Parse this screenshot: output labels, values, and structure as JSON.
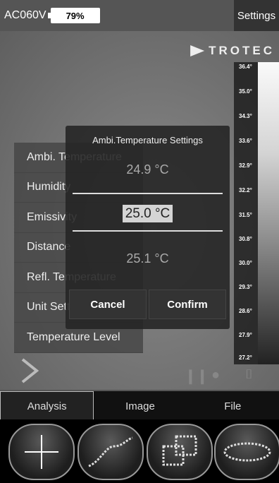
{
  "status": {
    "power": "AC060V",
    "battery": "79%",
    "settings_label": "Settings"
  },
  "brand": {
    "logo": "TROTEC"
  },
  "scale": {
    "ticks": [
      "36.4°",
      "35.0°",
      "34.3°",
      "33.6°",
      "32.9°",
      "32.2°",
      "31.5°",
      "30.8°",
      "30.0°",
      "29.3°",
      "28.6°",
      "27.9°",
      "27.2°"
    ]
  },
  "menu": {
    "items": [
      "Ambi. Temperature",
      "Humidity",
      "Emissivity",
      "Distance",
      "Refl. Temperature",
      "Unit Settings",
      "Temperature Level"
    ]
  },
  "dialog": {
    "title": "Ambi.Temperature Settings",
    "prev": "24.9 °C",
    "current": "25.0 °C",
    "next": "25.1 °C",
    "cancel": "Cancel",
    "confirm": "Confirm"
  },
  "tabs": [
    "Analysis",
    "Image",
    "File"
  ],
  "tools": [
    "crosshair-tool",
    "line-tool",
    "area-tool",
    "ellipse-tool"
  ]
}
